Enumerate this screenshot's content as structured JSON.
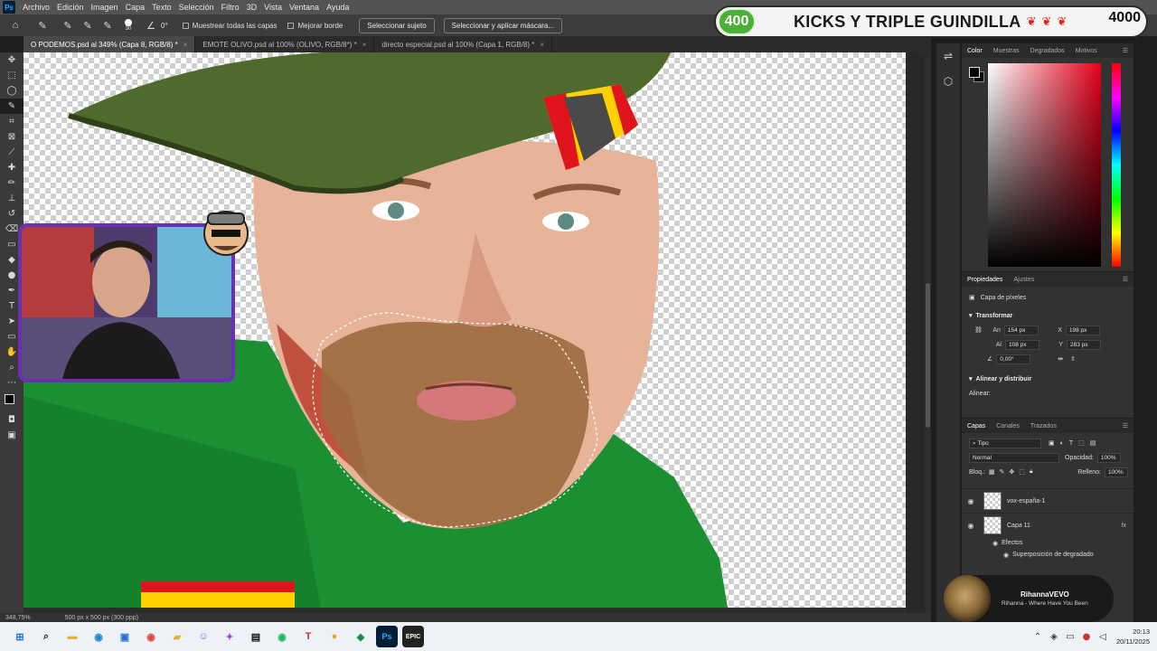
{
  "menubar": {
    "logo": "Ps",
    "items": [
      "Archivo",
      "Edición",
      "Imagen",
      "Capa",
      "Texto",
      "Selección",
      "Filtro",
      "3D",
      "Vista",
      "Ventana",
      "Ayuda"
    ]
  },
  "options": {
    "brush_size": "30",
    "angle": "0°",
    "sample_all_layers": "Muestrear todas las capas",
    "enhance_edge": "Mejorar borde",
    "select_subject": "Seleccionar sujeto",
    "select_and_mask": "Seleccionar y aplicar máscara..."
  },
  "overlay": {
    "goal_left": "400",
    "title": "KICKS Y TRIPLE GUINDILLA",
    "goal_right": "4000"
  },
  "tabs": [
    {
      "label": "O PODEMOS.psd al 349% (Capa 8, RGB/8) *",
      "close": "×"
    },
    {
      "label": "EMOTE OLIVO.psd al 100% (OLIVO, RGB/8*) *",
      "close": "×"
    },
    {
      "label": "directo especial.psd al 100% (Capa 1, RGB/8) *",
      "close": "×"
    }
  ],
  "status": {
    "zoom": "348,75%",
    "doc_size": "500 px x 500 px (300 ppp)"
  },
  "color_panel": {
    "tabs": [
      "Color",
      "Muestras",
      "Degradados",
      "Motivos"
    ],
    "fg_color": "#000000",
    "bg_color": "#000000",
    "hue": "#e3001a"
  },
  "properties": {
    "tabs": [
      "Propiedades",
      "Ajustes"
    ],
    "layer_kind": "Capa de píxeles",
    "transform_title": "Transformar",
    "w_label": "An",
    "w_value": "154 px",
    "x_label": "X",
    "x_value": "198 px",
    "h_label": "Al",
    "h_value": "108 px",
    "y_label": "Y",
    "y_value": "283 px",
    "angle_value": "0,00°",
    "align_title": "Alinear y distribuir",
    "align_label": "Alinear:"
  },
  "layers": {
    "tabs": [
      "Capas",
      "Canales",
      "Trazados"
    ],
    "filter": "Tipo",
    "blend": "Normal",
    "opacity_label": "Opacidad:",
    "opacity": "100%",
    "lock_label": "Bloq.:",
    "fill_label": "Relleno:",
    "fill": "100%",
    "items": [
      {
        "name": "vox-españa-1"
      },
      {
        "name": "Capa 11",
        "fx": "fx"
      }
    ],
    "effects_label": "Efectos",
    "effect_item": "Superposición de degradado"
  },
  "toast": {
    "title": "RihannaVEVO",
    "subtitle": "Rihanna - Where Have You Been"
  },
  "taskbar": {
    "clock_time": "20:13",
    "clock_date": "20/11/2025"
  }
}
